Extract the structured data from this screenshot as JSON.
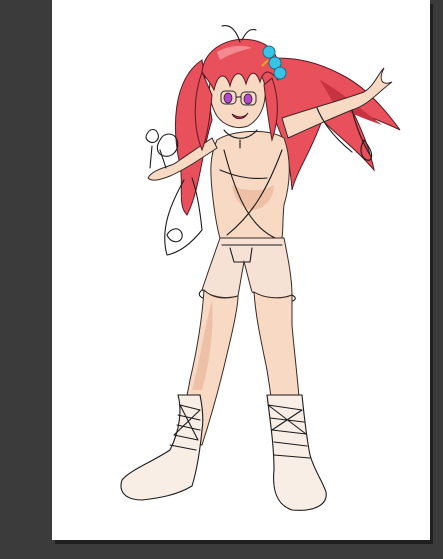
{
  "app": {
    "background_color": "#3b3b3b",
    "canvas_color": "#ffffff"
  },
  "artwork": {
    "subject": "",
    "palette": {
      "hair": "#e8505c",
      "skin": "#f7d9c4",
      "hair_beads": "#38c4e6",
      "eyes": "#b24ac8",
      "lineart": "#1b1b1b"
    }
  }
}
